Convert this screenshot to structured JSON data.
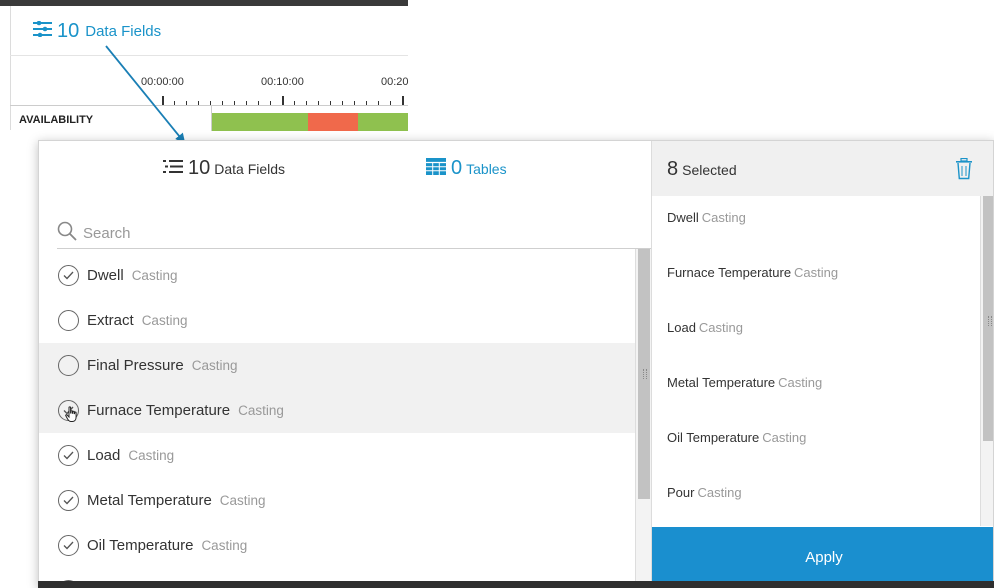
{
  "background": {
    "data_fields_trigger": {
      "icon": "filter-list-icon",
      "count": "10",
      "label": "Data Fields"
    },
    "timeline": {
      "tick_labels": [
        "00:00:00",
        "00:10:00",
        "00:20"
      ],
      "row_label": "AVAILABILITY",
      "availability_colors": {
        "up": "#8fc14f",
        "down": "#f0694b"
      }
    }
  },
  "popup": {
    "tabs": {
      "fields": {
        "icon": "list-icon",
        "count": "10",
        "label": "Data Fields"
      },
      "tables": {
        "icon": "table-icon",
        "count": "0",
        "label": "Tables"
      }
    },
    "search": {
      "icon": "search-icon",
      "placeholder": "Search",
      "value": ""
    },
    "fields": [
      {
        "name": "Dwell",
        "category": "Casting",
        "checked": true
      },
      {
        "name": "Extract",
        "category": "Casting",
        "checked": false
      },
      {
        "name": "Final Pressure",
        "category": "Casting",
        "checked": false
      },
      {
        "name": "Furnace Temperature",
        "category": "Casting",
        "checked": true
      },
      {
        "name": "Load",
        "category": "Casting",
        "checked": true
      },
      {
        "name": "Metal Temperature",
        "category": "Casting",
        "checked": true
      },
      {
        "name": "Oil Temperature",
        "category": "Casting",
        "checked": true
      }
    ],
    "selected": {
      "count": "8",
      "label": "Selected",
      "trash_icon": "trash-icon",
      "items": [
        {
          "name": "Dwell",
          "category": "Casting"
        },
        {
          "name": "Furnace Temperature",
          "category": "Casting"
        },
        {
          "name": "Load",
          "category": "Casting"
        },
        {
          "name": "Metal Temperature",
          "category": "Casting"
        },
        {
          "name": "Oil Temperature",
          "category": "Casting"
        },
        {
          "name": "Pour",
          "category": "Casting"
        }
      ]
    },
    "apply_label": "Apply"
  },
  "colors": {
    "accent": "#1a8fcf",
    "link": "#1a93c9"
  }
}
